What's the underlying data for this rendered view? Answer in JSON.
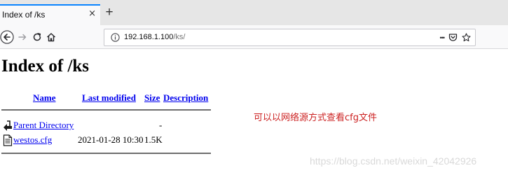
{
  "browser": {
    "tab_title": "Index of /ks",
    "tab_close_glyph": "×",
    "new_tab_glyph": "+",
    "url_host": "192.168.1.100",
    "url_path": "/ks/",
    "page_actions_glyph": "•••",
    "accent_color": "#0a84ff",
    "icons": [
      "back-icon",
      "forward-icon",
      "reload-icon",
      "home-icon",
      "info-icon",
      "more-icon",
      "pocket-icon",
      "bookmark-star-icon"
    ]
  },
  "page": {
    "title": "Index of /ks",
    "columns": {
      "name": "Name",
      "last_modified": "Last modified",
      "size": "Size",
      "description": "Description"
    },
    "rows": [
      {
        "name": "Parent Directory",
        "last_modified": "",
        "size": "-",
        "description": "",
        "icon": "parent-directory-icon"
      },
      {
        "name": "westos.cfg",
        "last_modified": "2021-01-28 10:30",
        "size": "1.5K",
        "description": "",
        "icon": "text-file-icon"
      }
    ],
    "link_color": "#0000ee"
  },
  "annotation": {
    "text": "可以以网络源方式查看cfg文件",
    "color": "#cc2222"
  },
  "watermark": {
    "text": "https://blog.csdn.net/weixin_42042926"
  }
}
